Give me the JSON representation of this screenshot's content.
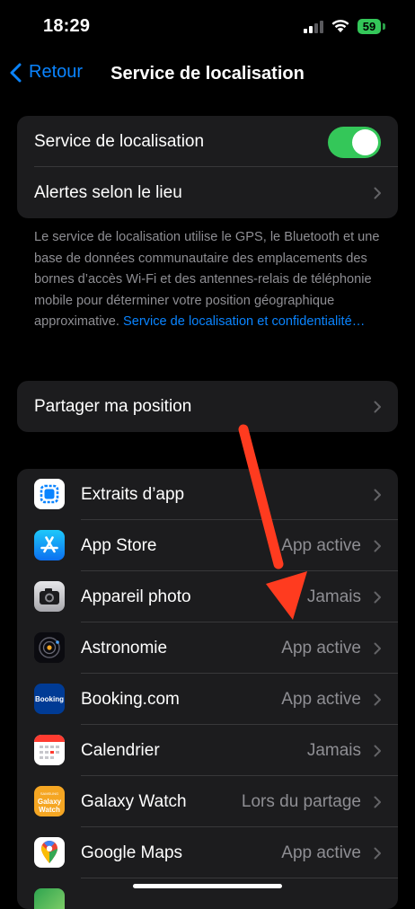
{
  "status_bar": {
    "time": "18:29",
    "battery": "59"
  },
  "nav": {
    "back_label": "Retour",
    "title": "Service de localisation"
  },
  "location_group": {
    "toggle_label": "Service de localisation",
    "toggle_on": true,
    "alerts_label": "Alertes selon le lieu"
  },
  "footnote": {
    "text": "Le service de localisation utilise le GPS, le Bluetooth et une base de données communautaire des emplacements des bornes d’accès Wi-Fi et des antennes-relais de téléphonie mobile pour déterminer votre position géographique approximative. ",
    "link": "Service de localisation et confidentialité…"
  },
  "share_label": "Partager ma position",
  "apps": [
    {
      "name": "Extraits d’app",
      "value": "",
      "icon": "app-clips-icon"
    },
    {
      "name": "App Store",
      "value": "App active",
      "icon": "app-store-icon"
    },
    {
      "name": "Appareil photo",
      "value": "Jamais",
      "icon": "camera-icon"
    },
    {
      "name": "Astronomie",
      "value": "App active",
      "icon": "astronomy-icon"
    },
    {
      "name": "Booking.com",
      "value": "App active",
      "icon": "booking-icon"
    },
    {
      "name": "Calendrier",
      "value": "Jamais",
      "icon": "calendar-icon"
    },
    {
      "name": "Galaxy Watch",
      "value": "Lors du partage",
      "icon": "galaxy-watch-icon"
    },
    {
      "name": "Google Maps",
      "value": "App active",
      "icon": "google-maps-icon"
    }
  ],
  "icon_text": {
    "booking": "Booking",
    "galaxy_line1": "Galaxy",
    "galaxy_line2": "Watch",
    "galaxy_brand": "SAMSUNG"
  },
  "colors": {
    "accent": "#0a84ff",
    "toggle_on": "#34c759",
    "annotation_arrow": "#ff3b1f",
    "cell_bg": "#1c1c1e"
  }
}
